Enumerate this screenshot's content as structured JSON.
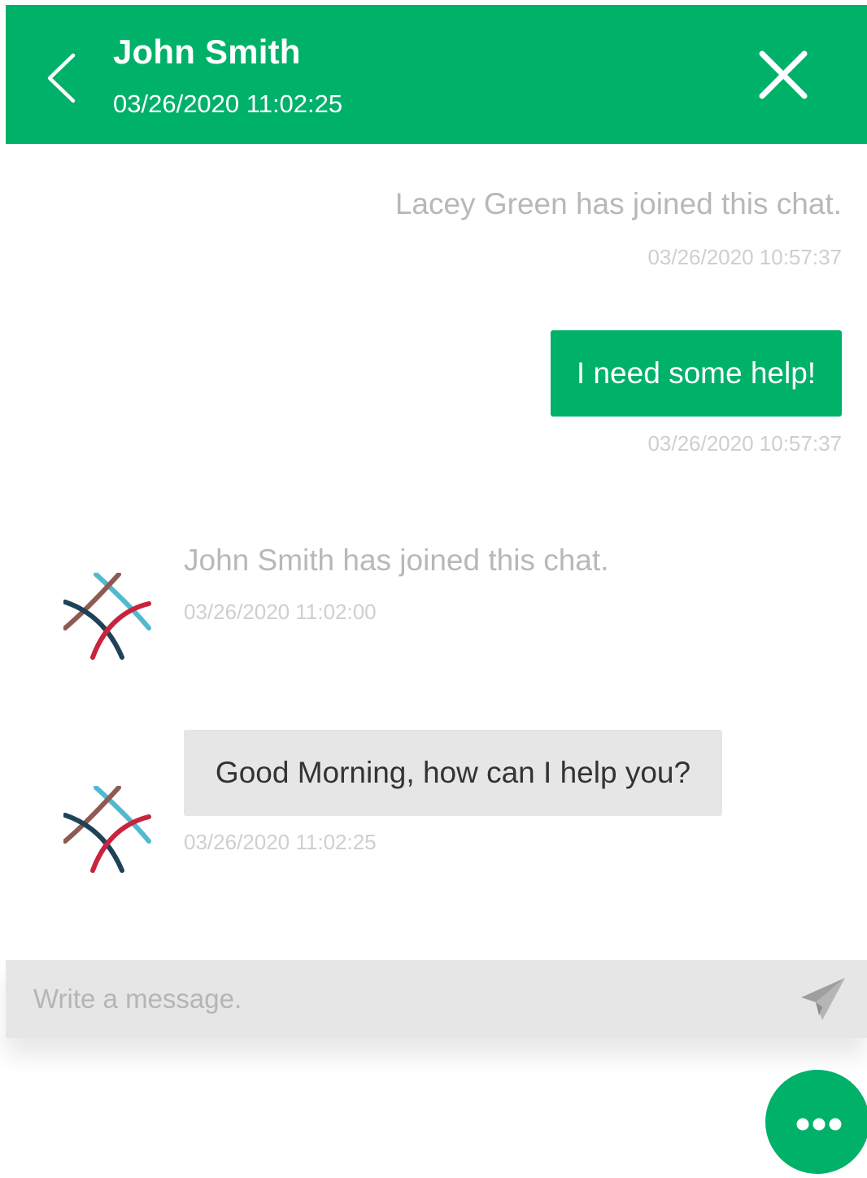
{
  "header": {
    "title": "John Smith",
    "timestamp": "03/26/2020 11:02:25",
    "back_icon": "chevron-left-icon",
    "close_icon": "close-icon"
  },
  "messages": [
    {
      "type": "system",
      "text": "Lacey Green has joined this chat.",
      "time": "03/26/2020 10:57:37"
    },
    {
      "type": "outgoing",
      "text": "I need some help!",
      "time": "03/26/2020 10:57:37"
    },
    {
      "type": "system",
      "text": "John Smith has joined this chat.",
      "time": "03/26/2020 11:02:00"
    },
    {
      "type": "incoming",
      "text": "Good Morning, how can I help you?",
      "time": "03/26/2020 11:02:25"
    }
  ],
  "composer": {
    "placeholder": "Write a message.",
    "send_icon": "send-icon"
  },
  "fab": {
    "icon": "more-dots-icon"
  },
  "colors": {
    "accent": "#00b16a",
    "incoming_bubble": "#e6e6e6",
    "composer_bg": "#e6e6e6",
    "system_text": "#b8b8b8",
    "timestamp_text": "#cfcfcf"
  },
  "avatar_logo": {
    "icon": "agent-logo-icon",
    "colors": [
      "#52b9cf",
      "#8f5a52",
      "#1f4258",
      "#c8243d"
    ]
  }
}
